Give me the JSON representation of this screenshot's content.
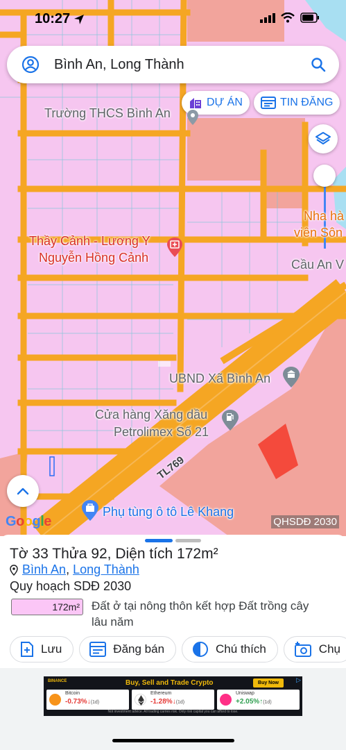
{
  "status_bar": {
    "time": "10:27"
  },
  "search": {
    "query": "Bình An, Long Thành"
  },
  "chips": {
    "projects": "DỰ ÁN",
    "listings": "TIN ĐĂNG"
  },
  "map": {
    "pois": {
      "school": "Trường THCS Bình An",
      "clinic_line1": "Thầy Cảnh - Lương Y",
      "clinic_line2": "Nguyễn Hồng Cảnh",
      "nha_hang_1": "Nha hà",
      "nha_hang_2": "viên Sôn",
      "bridge": "Cầu An V",
      "ubnd": "UBND Xã Bình An",
      "gas_line1": "Cửa hàng Xăng dầu",
      "gas_line2": "Petrolimex Số 21",
      "parts": "Phụ tùng ô tô Lê Khang"
    },
    "road": "TL769",
    "attribution": "Google",
    "layer_tag": "QHSDĐ 2030"
  },
  "sheet": {
    "title": "Tờ 33 Thửa 92, Diện tích 172m²",
    "location": {
      "ward": "Bình An",
      "sep": ",",
      "district": "Long Thành"
    },
    "plan_label": "Quy hoạch SDĐ 2030",
    "area": "172m²",
    "land_type": "Đất ở tại nông thôn kết hợp Đất trồng cây lâu năm",
    "actions": {
      "save": "Lưu",
      "post": "Đăng bán",
      "legend": "Chú thích",
      "photo": "Chụ"
    }
  },
  "ad": {
    "brand": "BINANCE",
    "headline": "Buy, Sell and Trade Crypto",
    "cta": "Buy Now",
    "coins": [
      {
        "name": "Bitcoin",
        "change": "-0.73%",
        "period": "(1d)"
      },
      {
        "name": "Ethereum",
        "change": "-1.28%",
        "period": "(1d)"
      },
      {
        "name": "Uniswap",
        "change": "+2.05%",
        "period": "(1d)"
      }
    ],
    "disclaimer": "Not investment advice. All trading carries risk. Only risk capital you can afford to lose."
  },
  "colors": {
    "residential": "#f6c6f0",
    "road": "#f5a623",
    "commercial": "#f2a49c",
    "selected_parcel": "#f44a3c",
    "water": "#a8dff2",
    "accent": "#1a73e8"
  }
}
